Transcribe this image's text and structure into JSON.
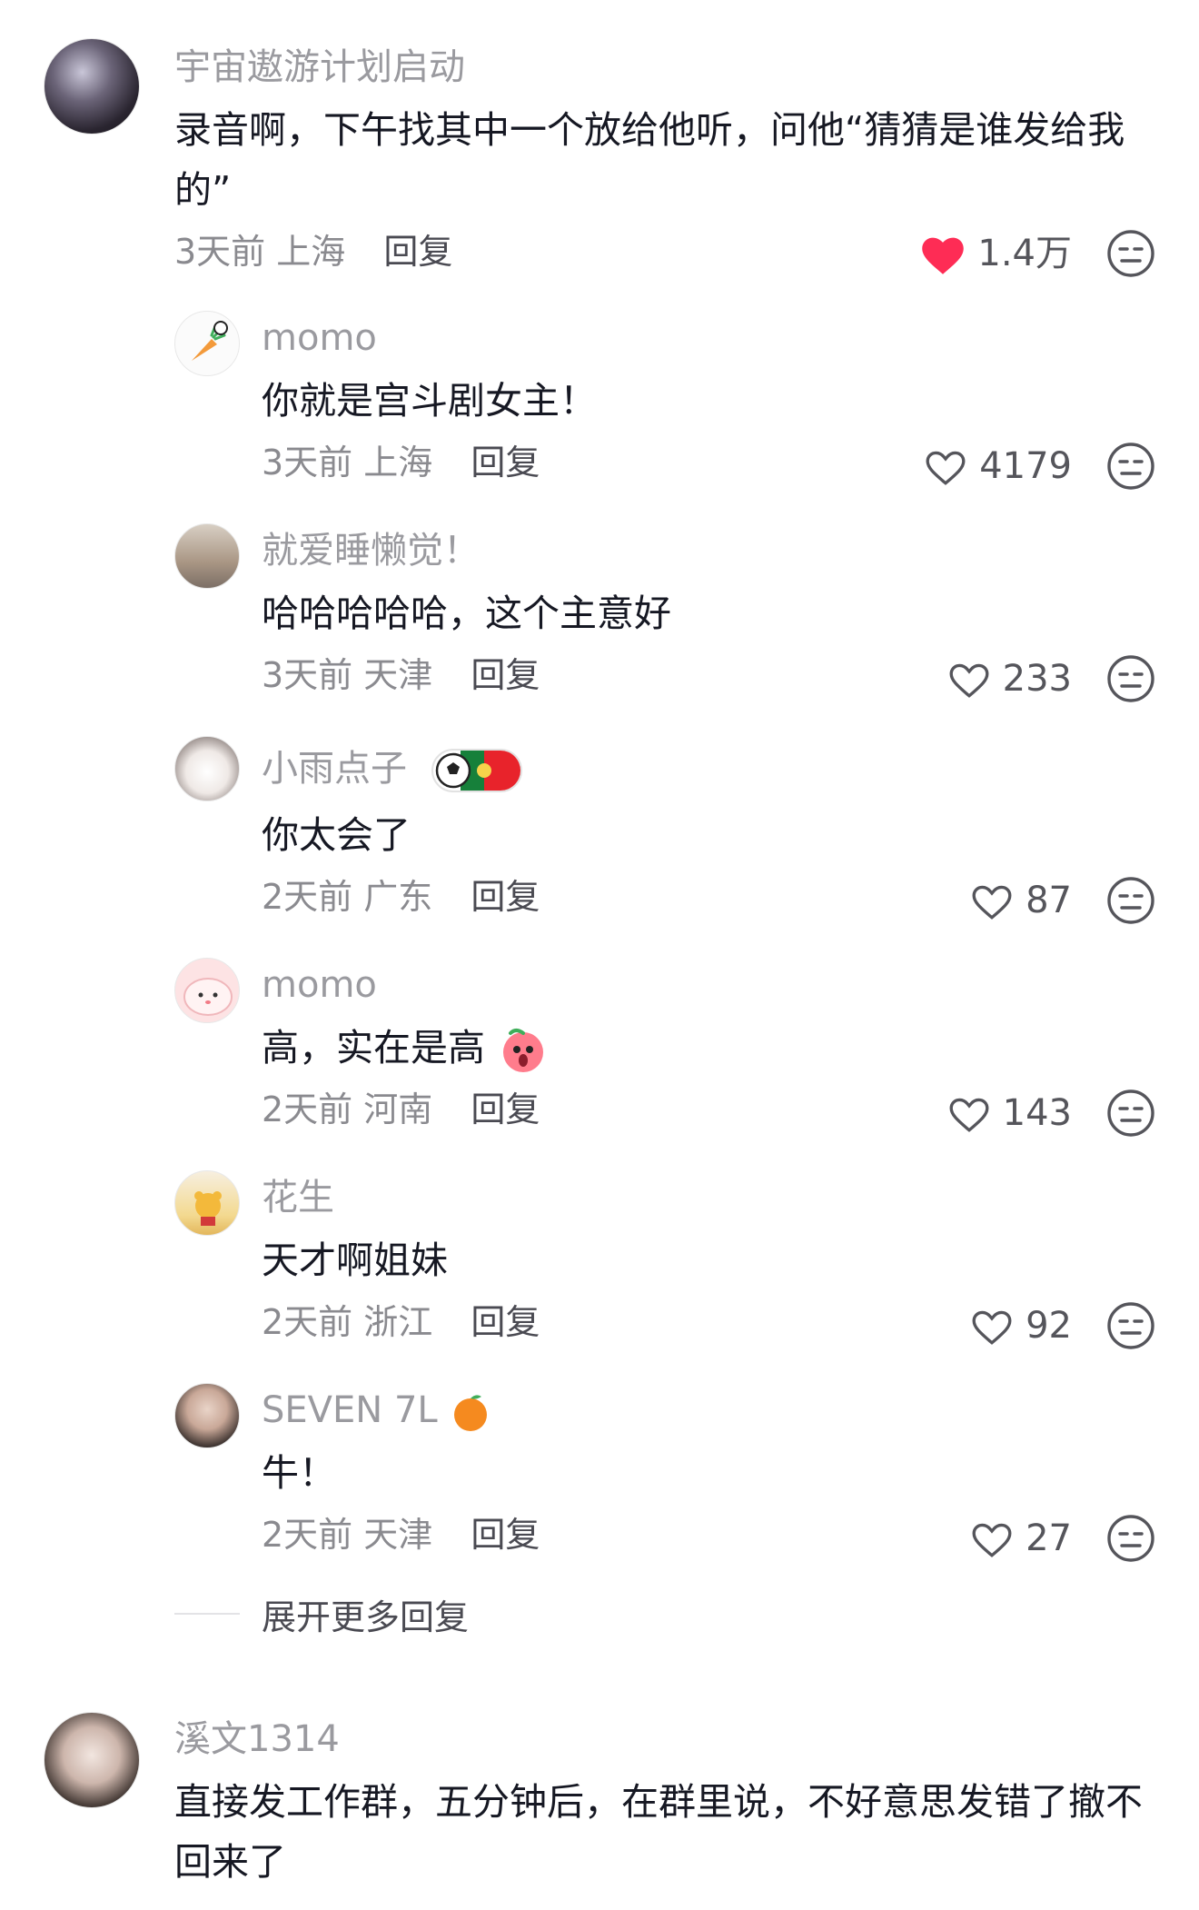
{
  "comments": [
    {
      "user": "宇宙遨游计划启动",
      "text": "录音啊，下午找其中一个放给他听，问他“猜猜是谁发给我的”",
      "time": "3天前",
      "location": "上海",
      "reply": "回复",
      "likes": "1.4万",
      "liked": true
    },
    {
      "user": "momo",
      "text": "你就是宫斗剧女主！",
      "time": "3天前",
      "location": "上海",
      "reply": "回复",
      "likes": "4179"
    },
    {
      "user": "就爱睡懒觉！",
      "text": "哈哈哈哈哈，这个主意好",
      "time": "3天前",
      "location": "天津",
      "reply": "回复",
      "likes": "233"
    },
    {
      "user": "小雨点子",
      "text": "你太会了",
      "time": "2天前",
      "location": "广东",
      "reply": "回复",
      "likes": "87"
    },
    {
      "user": "momo",
      "text": "高，实在是高",
      "time": "2天前",
      "location": "河南",
      "reply": "回复",
      "likes": "143"
    },
    {
      "user": "花生",
      "text": "天才啊姐妹",
      "time": "2天前",
      "location": "浙江",
      "reply": "回复",
      "likes": "92"
    },
    {
      "user": "SEVEN 7L",
      "text": "牛！",
      "time": "2天前",
      "location": "天津",
      "reply": "回复",
      "likes": "27"
    },
    {
      "user": "溪文1314",
      "text": "直接发工作群，五分钟后，在群里说，不好意思发错了撤不回来了"
    }
  ],
  "expand_label": "展开更多回复",
  "colors": {
    "like_active": "#fe2c55",
    "icon_gray": "#55555b"
  }
}
